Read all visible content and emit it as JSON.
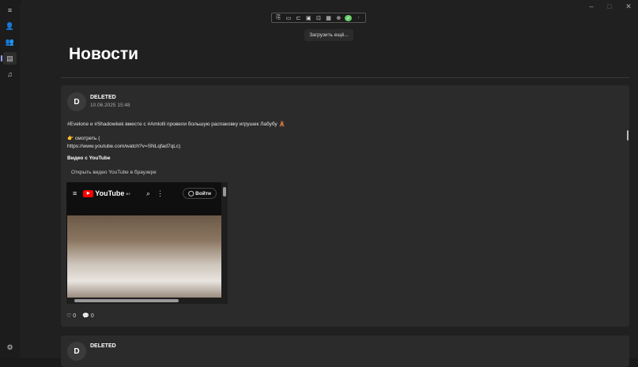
{
  "window": {
    "minimize": "–",
    "maximize": "□",
    "close": "✕"
  },
  "sidebar": {
    "items": [
      {
        "name": "menu",
        "glyph": "≡"
      },
      {
        "name": "profile",
        "glyph": "👤"
      },
      {
        "name": "friends",
        "glyph": "👥"
      },
      {
        "name": "news",
        "glyph": "▤"
      },
      {
        "name": "music",
        "glyph": "♫"
      }
    ],
    "settings": "⚙"
  },
  "toolbar": {
    "icons": [
      "⎘",
      "▭",
      "⊏",
      "▣",
      "⊡",
      "▦",
      "⊕",
      "✓",
      "‹"
    ],
    "tooltip": "Загрузить ещё..."
  },
  "page": {
    "title": "Новости"
  },
  "posts": [
    {
      "avatar": "D",
      "author": "DELETED",
      "date": "10.06.2025 15:48",
      "text": "#Evelone и #Shadowkek вместе с #Amlolli провели большую распаковку игрушек Лабубу 🧸",
      "watch": "👉 смотреть (",
      "link": "https://www.youtube.com/watch?v=SNLqfad7qLc)",
      "video_heading": "Видео с YouTube",
      "open_button": "Открыть видео YouTube в браузере",
      "youtube": {
        "logo": "YouTube",
        "region": "BY",
        "login": "Войти"
      },
      "likes": "0",
      "comments": "0"
    },
    {
      "avatar": "D",
      "author": "DELETED"
    }
  ]
}
